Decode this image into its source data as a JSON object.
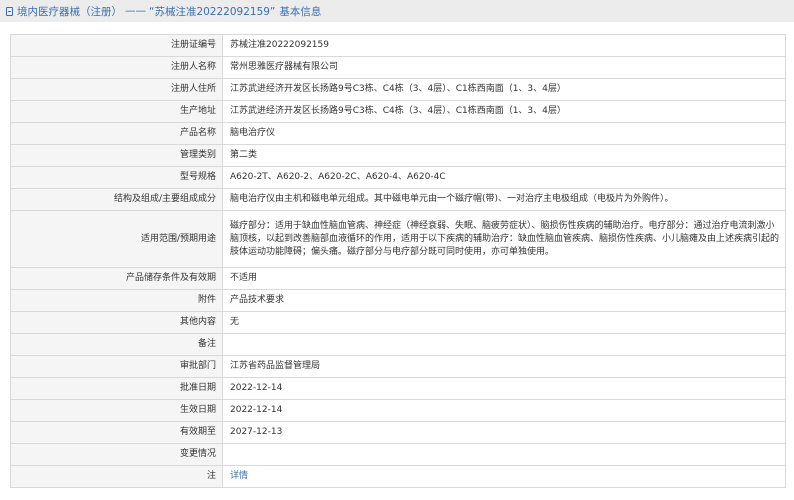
{
  "header": {
    "crumb": "境内医疗器械（注册）",
    "separator": "——",
    "reg_no_quoted": "“苏械注准20222092159”",
    "suffix": "基本信息"
  },
  "rows": [
    {
      "label": "注册证编号",
      "value": "苏械注准20222092159"
    },
    {
      "label": "注册人名称",
      "value": "常州思雅医疗器械有限公司"
    },
    {
      "label": "注册人住所",
      "value": "江苏武进经济开发区长扬路9号C3栋、C4栋（3、4层）、C1栋西南面（1、3、4层）"
    },
    {
      "label": "生产地址",
      "value": "江苏武进经济开发区长扬路9号C3栋、C4栋（3、4层）、C1栋西南面（1、3、4层）"
    },
    {
      "label": "产品名称",
      "value": "脑电治疗仪"
    },
    {
      "label": "管理类别",
      "value": "第二类"
    },
    {
      "label": "型号规格",
      "value": "A620-2T、A620-2、A620-2C、A620-4、A620-4C"
    },
    {
      "label": "结构及组成/主要组成成分",
      "value": "脑电治疗仪由主机和磁电单元组成。其中磁电单元由一个磁疗帽(带)、一对治疗主电极组成（电极片为外购件）。"
    },
    {
      "label": "适用范围/预期用途",
      "value": "磁疗部分：适用于缺血性脑血管病、神经症（神经衰弱、失眠、脑疲劳症状）、脑损伤性疾病的辅助治疗。电疗部分：通过治疗电流刺激小脑顶核，以起到改善脑部血液循环的作用，适用于以下疾病的辅助治疗：缺血性脑血管疾病、脑损伤性疾病、小儿脑瘫及由上述疾病引起的肢体运动功能障碍；偏头痛。磁疗部分与电疗部分既可同时使用，亦可单独使用。"
    },
    {
      "label": "产品储存条件及有效期",
      "value": "不适用"
    },
    {
      "label": "附件",
      "value": "产品技术要求"
    },
    {
      "label": "其他内容",
      "value": "无"
    },
    {
      "label": "备注",
      "value": ""
    },
    {
      "label": "审批部门",
      "value": "江苏省药品监督管理局"
    },
    {
      "label": "批准日期",
      "value": "2022-12-14"
    },
    {
      "label": "生效日期",
      "value": "2022-12-14"
    },
    {
      "label": "有效期至",
      "value": "2027-12-13"
    },
    {
      "label": "变更情况",
      "value": ""
    },
    {
      "label": "注",
      "value": "详情"
    }
  ]
}
